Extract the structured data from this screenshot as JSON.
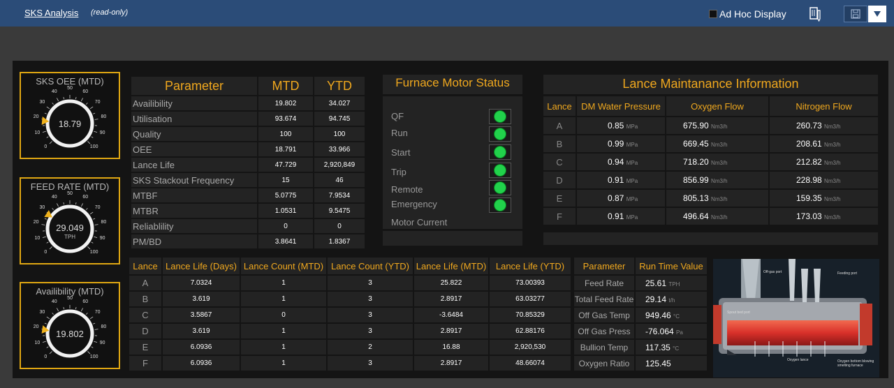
{
  "header": {
    "title": "SKS Analysis",
    "mode": "(read-only)",
    "adhoc_label": "Ad Hoc Display"
  },
  "colors": {
    "accent": "#f0a81e",
    "gauge_border": "#e0a712",
    "led_on": "#21d24b",
    "header_bg": "#2b4c78"
  },
  "gauges": [
    {
      "title": "SKS OEE (MTD)",
      "value": "18.79",
      "unit": "",
      "level": 18.79,
      "ticks": [
        "0",
        "10",
        "20",
        "30",
        "40",
        "50",
        "60",
        "70",
        "80",
        "90",
        "100"
      ]
    },
    {
      "title": "FEED RATE (MTD)",
      "value": "29.049",
      "unit": "TPH",
      "level": 29.049,
      "ticks": [
        "0",
        "10",
        "20",
        "30",
        "40",
        "50",
        "60",
        "70",
        "80",
        "90",
        "100"
      ]
    },
    {
      "title": "Availibility (MTD)",
      "value": "19.802",
      "unit": "",
      "level": 19.802,
      "ticks": [
        "0",
        "10",
        "20",
        "30",
        "40",
        "50",
        "60",
        "70",
        "80",
        "90",
        "100"
      ]
    }
  ],
  "parameter_table": {
    "headers": [
      "Parameter",
      "MTD",
      "YTD"
    ],
    "rows": [
      [
        "Availibility",
        "19.802",
        "34.027"
      ],
      [
        "Utilisation",
        "93.674",
        "94.745"
      ],
      [
        "Quality",
        "100",
        "100"
      ],
      [
        "OEE",
        "18.791",
        "33.966"
      ],
      [
        "Lance Life",
        "47.729",
        "2,920,849"
      ],
      [
        "SKS Stackout Frequency",
        "15",
        "46"
      ],
      [
        "MTBF",
        "5.0775",
        "7.9534"
      ],
      [
        "MTBR",
        "1.0531",
        "9.5475"
      ],
      [
        "Reliablility",
        "0",
        "0"
      ],
      [
        "PM/BD",
        "3.8641",
        "1.8367"
      ]
    ]
  },
  "motor_status": {
    "title": "Furnace Motor Status",
    "items": [
      "QF",
      "Run",
      "Start",
      "Trip",
      "Remote",
      "Emergency"
    ],
    "current_label": "Motor Current"
  },
  "lance_maint": {
    "title": "Lance Maintanance Information",
    "headers": [
      "Lance",
      "DM Water Pressure",
      "Oxygen Flow",
      "Nitrogen Flow"
    ],
    "units": [
      "MPa",
      "Nm3/h",
      "Nm3/h"
    ],
    "rows": [
      [
        "A",
        "0.85",
        "675.90",
        "260.73"
      ],
      [
        "B",
        "0.99",
        "669.45",
        "208.61"
      ],
      [
        "C",
        "0.94",
        "718.20",
        "212.82"
      ],
      [
        "D",
        "0.91",
        "856.99",
        "228.98"
      ],
      [
        "E",
        "0.87",
        "805.13",
        "159.35"
      ],
      [
        "F",
        "0.91",
        "496.64",
        "173.03"
      ]
    ]
  },
  "lance_life": {
    "headers": [
      "Lance",
      "Lance Life (Days)",
      "Lance Count (MTD)",
      "Lance Count (YTD)",
      "Lance Life (MTD)",
      "Lance Life (YTD)"
    ],
    "rows": [
      [
        "A",
        "7.0324",
        "1",
        "3",
        "25.822",
        "73.00393"
      ],
      [
        "B",
        "3.619",
        "1",
        "3",
        "2.8917",
        "63.03277"
      ],
      [
        "C",
        "3.5867",
        "0",
        "3",
        "-3.6484",
        "70.85329"
      ],
      [
        "D",
        "3.619",
        "1",
        "3",
        "2.8917",
        "62.88176"
      ],
      [
        "E",
        "6.0936",
        "1",
        "2",
        "16.88",
        "2,920,530"
      ],
      [
        "F",
        "6.0936",
        "1",
        "3",
        "2.8917",
        "48.66074"
      ]
    ]
  },
  "runtime": {
    "headers": [
      "Parameter",
      "Run Time Value"
    ],
    "rows": [
      [
        "Feed Rate",
        "25.61",
        "TPH"
      ],
      [
        "Total Feed Rate",
        "29.14",
        "t/h"
      ],
      [
        "Off Gas Temp",
        "949.46",
        "°C"
      ],
      [
        "Off Gas Press",
        "-76.064",
        "Pa"
      ],
      [
        "Bullion Temp",
        "117.35",
        "°C"
      ],
      [
        "Oxygen Ratio",
        "125.45",
        ""
      ]
    ]
  },
  "furnace_labels": {
    "offgas": "Off-gas port",
    "feeding": "Feeding port",
    "spout": "Spout bed port",
    "oxygen": "Oxygen lance",
    "blowing": "Oxygen bottom blowing smelting furnace"
  }
}
